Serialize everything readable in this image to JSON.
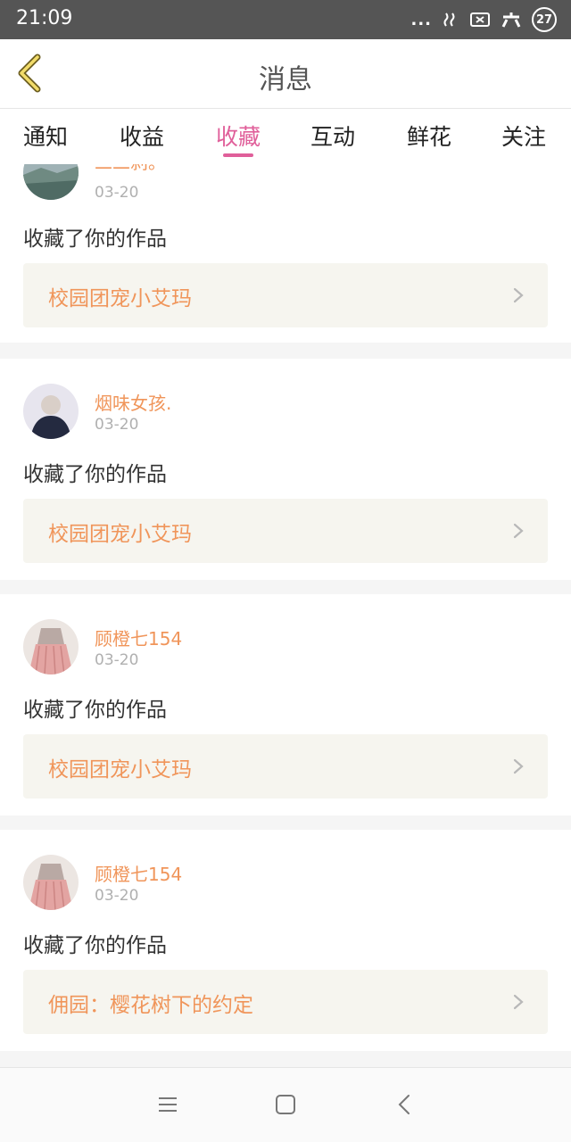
{
  "status_bar": {
    "time": "21:09",
    "dots": "...",
    "battery_level": "27",
    "icons": [
      "signal-icon",
      "close-box-icon",
      "network-icon",
      "battery-icon"
    ]
  },
  "header": {
    "title": "消息",
    "back_icon": "chevron-left-icon"
  },
  "tabs": [
    {
      "label": "通知",
      "active": false
    },
    {
      "label": "收益",
      "active": false
    },
    {
      "label": "收藏",
      "active": true
    },
    {
      "label": "互动",
      "active": false
    },
    {
      "label": "鲜花",
      "active": false
    },
    {
      "label": "关注",
      "active": false
    }
  ],
  "feed": {
    "items": [
      {
        "username": "二二刹。",
        "date": "03-20",
        "action": "收藏了你的作品",
        "work_title": "校园团宠小艾玛"
      },
      {
        "username": "烟味女孩.",
        "date": "03-20",
        "action": "收藏了你的作品",
        "work_title": "校园团宠小艾玛"
      },
      {
        "username": "顾橙七154",
        "date": "03-20",
        "action": "收藏了你的作品",
        "work_title": "校园团宠小艾玛"
      },
      {
        "username": "顾橙七154",
        "date": "03-20",
        "action": "收藏了你的作品",
        "work_title": "佣园：樱花树下的约定"
      }
    ]
  },
  "colors": {
    "accent": "#e05f9a",
    "name_orange": "#f0955a",
    "link_bg": "#f6f5ef",
    "status_bg": "#555555"
  },
  "nav": {
    "icons": [
      "menu-icon",
      "home-square-icon",
      "back-arrow-icon"
    ]
  }
}
